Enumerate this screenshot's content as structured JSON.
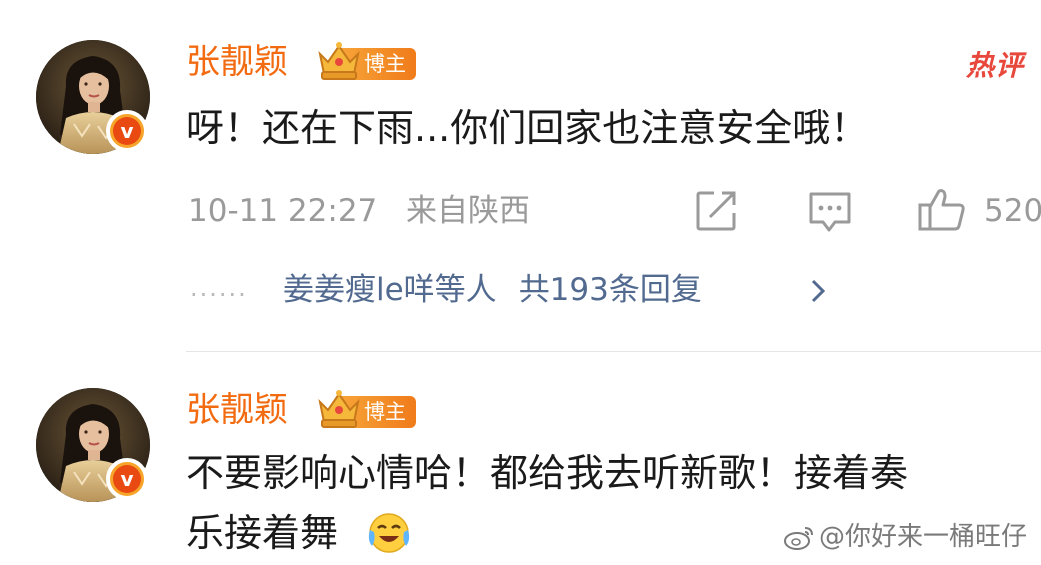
{
  "comments": [
    {
      "username": "张靓颖",
      "role_badge": "博主",
      "hot_tag": "热评",
      "text": "呀！还在下雨...你们回家也注意安全哦！",
      "date": "10-11 22:27",
      "location": "来自陕西",
      "like_count": "520",
      "replies_users": "姜姜瘦le咩等人",
      "replies_total": "共193条回复",
      "dots": "......"
    },
    {
      "username": "张靓颖",
      "role_badge": "博主",
      "text_line1": "不要影响心情哈！都给我去听新歌！接着奏",
      "text_line2": "乐接着舞"
    }
  ],
  "watermark": "@你好来一桶旺仔",
  "icons": {
    "verified": "verified-v-icon",
    "crown": "crown-icon",
    "share": "share-icon",
    "comment": "comment-icon",
    "like": "thumbs-up-icon",
    "chevron": "chevron-right-icon",
    "emoji": "crying-laughing-emoji-icon",
    "weibo": "weibo-logo-icon"
  },
  "colors": {
    "username": "#f36b10",
    "link": "#526a8f",
    "meta": "#9a9a9a",
    "hot": "#e8483c",
    "badge": "#f07b1a"
  }
}
